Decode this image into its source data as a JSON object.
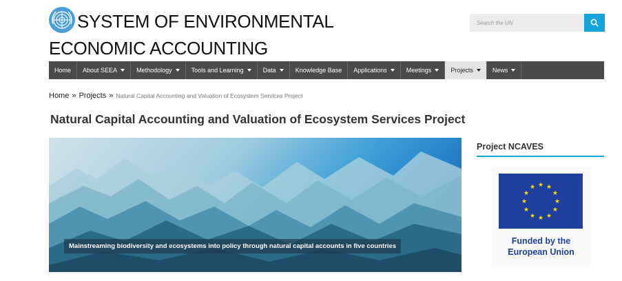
{
  "header": {
    "site_title": "SYSTEM OF ENVIRONMENTAL ECONOMIC ACCOUNTING",
    "logo_icon": "un-emblem-icon"
  },
  "search": {
    "placeholder": "Search the UN",
    "button_icon": "search-icon",
    "accent": "#15a4dc"
  },
  "nav": {
    "items": [
      {
        "label": "Home"
      },
      {
        "label": "About SEEA"
      },
      {
        "label": "Methodology"
      },
      {
        "label": "Tools and Learning"
      },
      {
        "label": "Data"
      },
      {
        "label": "Knowledge Base"
      },
      {
        "label": "Applications"
      },
      {
        "label": "Meetings"
      },
      {
        "label": "Projects"
      },
      {
        "label": "News"
      }
    ]
  },
  "breadcrumb": {
    "home": "Home",
    "sep": "»",
    "projects": "Projects",
    "current": "Natural Capital Accounting and Valuation of Ecosystem Services Project"
  },
  "page": {
    "title": "Natural Capital Accounting and Valuation of Ecosystem Services Project",
    "hero_caption": "Mainstreaming biodiversity and ecosystems into policy through natural capital accounts in five countries"
  },
  "sidebar": {
    "title": "Project NCAVES",
    "eu_line1": "Funded by the",
    "eu_line2": "European Union"
  }
}
